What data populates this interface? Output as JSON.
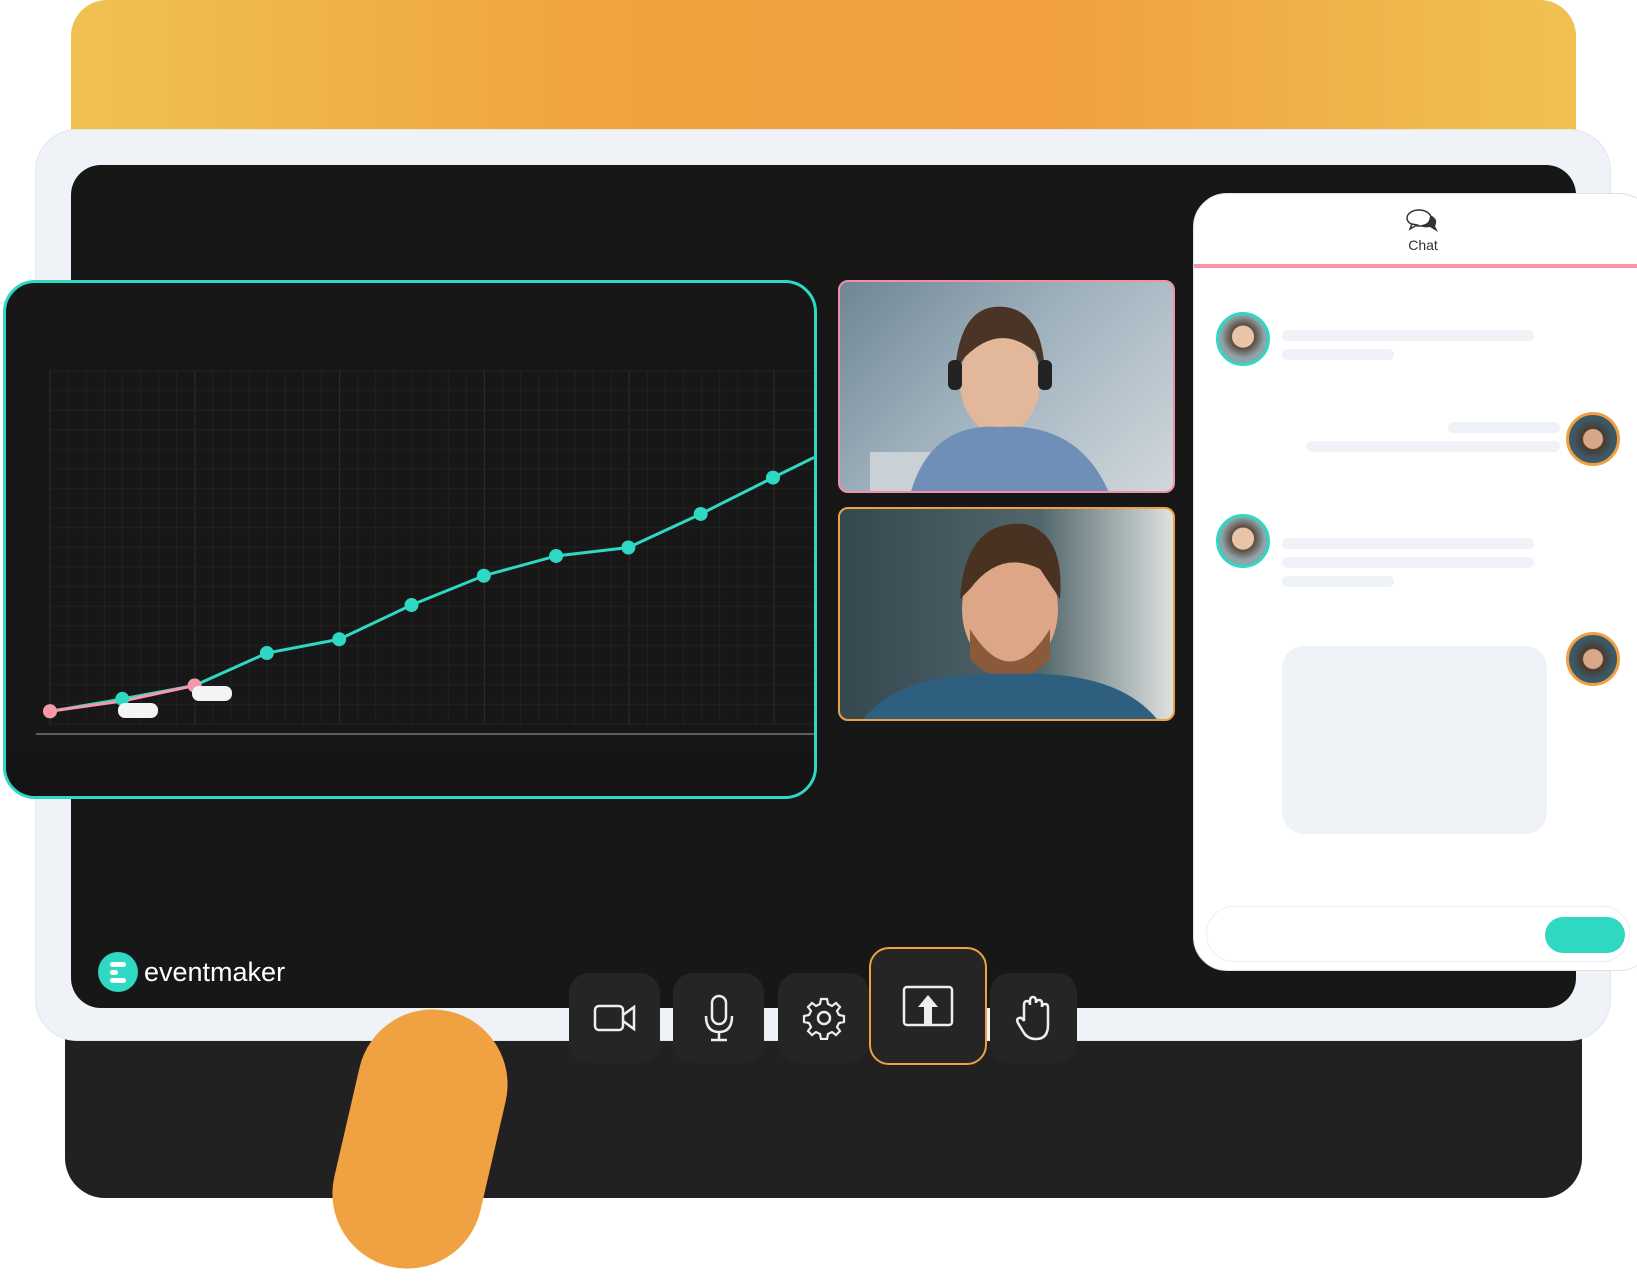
{
  "brand": {
    "name": "eventmaker",
    "accent": "#2ed8c3",
    "orange": "#f0a040",
    "pink": "#f797a9"
  },
  "chat": {
    "title": "Chat",
    "icon": "chat-bubbles-icon",
    "send_button": "send"
  },
  "toolbar": {
    "buttons": [
      {
        "name": "camera",
        "icon": "video-camera-icon"
      },
      {
        "name": "microphone",
        "icon": "microphone-icon"
      },
      {
        "name": "settings",
        "icon": "gear-icon"
      },
      {
        "name": "share-screen",
        "icon": "share-screen-icon",
        "active": true
      },
      {
        "name": "raise-hand",
        "icon": "hand-icon"
      }
    ]
  },
  "chart_data": {
    "type": "line",
    "title": "",
    "xlabel": "",
    "ylabel": "",
    "ylim": [
      0,
      100
    ],
    "grid": true,
    "series": [
      {
        "color": "#2ed8c3",
        "x": [
          1,
          2,
          3,
          4,
          5,
          6,
          7,
          8,
          9,
          10,
          11
        ],
        "values": [
          3.6,
          7.1,
          10.9,
          20.1,
          24,
          33.7,
          42,
          47.6,
          50,
          59.5,
          69.8
        ]
      },
      {
        "color": "#f797a9",
        "x": [
          1,
          2,
          3
        ],
        "values": [
          3.6,
          6.5,
          10.9
        ]
      }
    ]
  }
}
